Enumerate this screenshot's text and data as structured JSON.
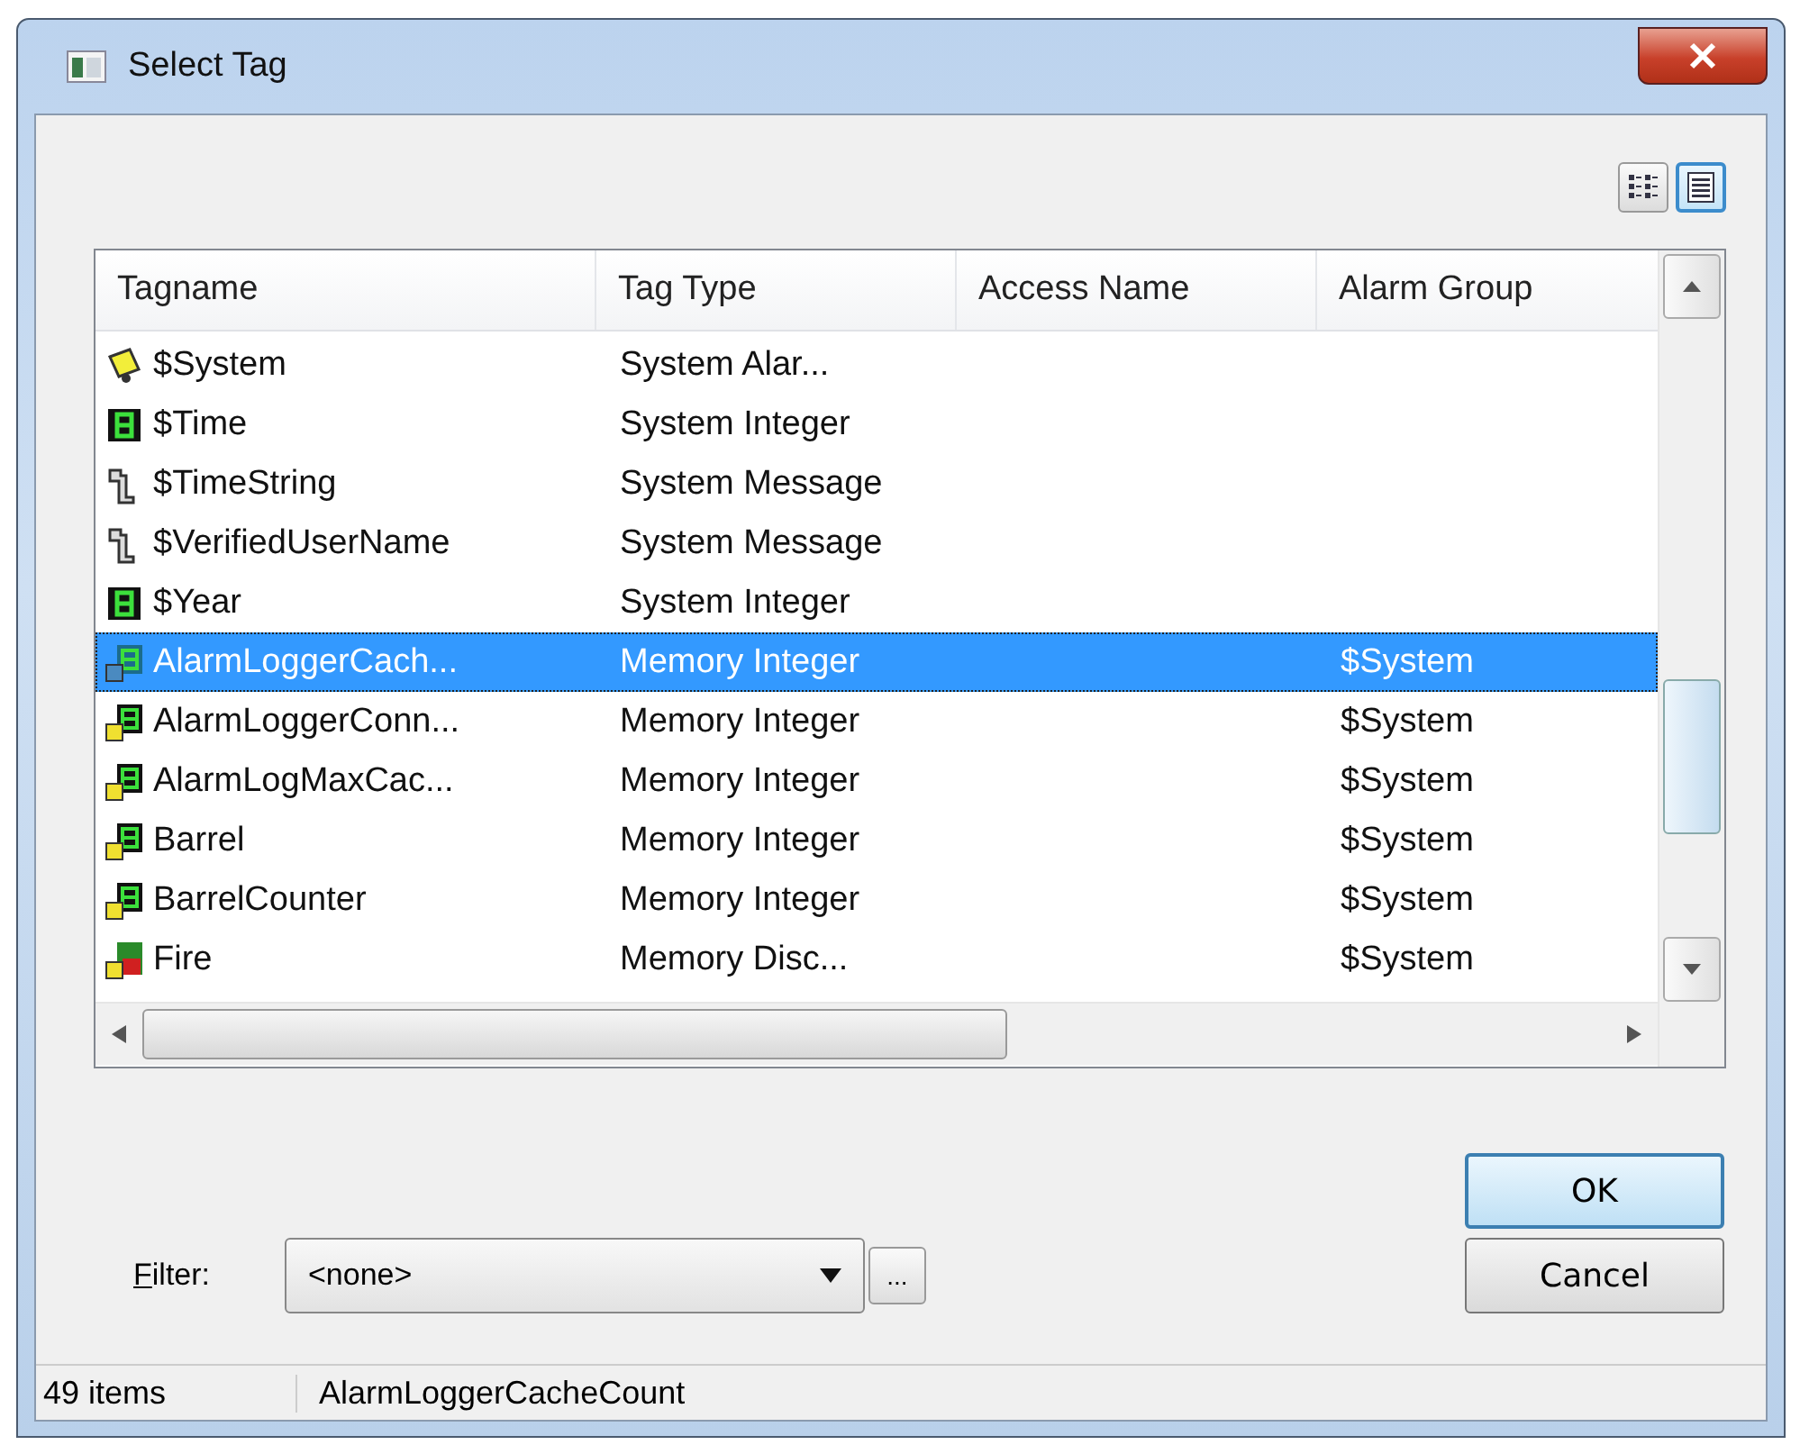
{
  "window": {
    "title": "Select Tag"
  },
  "view_toggle": [
    {
      "kind": "list",
      "selected": false
    },
    {
      "kind": "details",
      "selected": true
    }
  ],
  "table": {
    "columns": [
      "Tagname",
      "Tag Type",
      "Access Name",
      "Alarm Group"
    ],
    "rows": [
      {
        "kind": "alarm",
        "selected": false,
        "cells": [
          "$System",
          "System Alar...",
          "",
          ""
        ]
      },
      {
        "kind": "integer",
        "selected": false,
        "cells": [
          "$Time",
          "System Integer",
          "",
          ""
        ]
      },
      {
        "kind": "message",
        "selected": false,
        "cells": [
          "$TimeString",
          "System Message",
          "",
          ""
        ]
      },
      {
        "kind": "message",
        "selected": false,
        "cells": [
          "$VerifiedUserName",
          "System Message",
          "",
          ""
        ]
      },
      {
        "kind": "integer",
        "selected": false,
        "cells": [
          "$Year",
          "System Integer",
          "",
          ""
        ]
      },
      {
        "kind": "memory_integer",
        "selected": true,
        "cells": [
          "AlarmLoggerCach...",
          "Memory Integer",
          "",
          "$System"
        ]
      },
      {
        "kind": "memory_integer",
        "selected": false,
        "cells": [
          "AlarmLoggerConn...",
          "Memory Integer",
          "",
          "$System"
        ]
      },
      {
        "kind": "memory_integer",
        "selected": false,
        "cells": [
          "AlarmLogMaxCac...",
          "Memory Integer",
          "",
          "$System"
        ]
      },
      {
        "kind": "memory_integer",
        "selected": false,
        "cells": [
          "Barrel",
          "Memory Integer",
          "",
          "$System"
        ]
      },
      {
        "kind": "memory_integer",
        "selected": false,
        "cells": [
          "BarrelCounter",
          "Memory Integer",
          "",
          "$System"
        ]
      },
      {
        "kind": "memory_discrete",
        "selected": false,
        "cells": [
          "Fire",
          "Memory Disc...",
          "",
          "$System"
        ]
      }
    ]
  },
  "buttons": [
    "OK",
    "Cancel"
  ],
  "filter": {
    "label": "Filter:",
    "value": "<none>",
    "browse": "..."
  },
  "status_bar": {
    "count": "49 items",
    "selection": "AlarmLoggerCacheCount"
  }
}
